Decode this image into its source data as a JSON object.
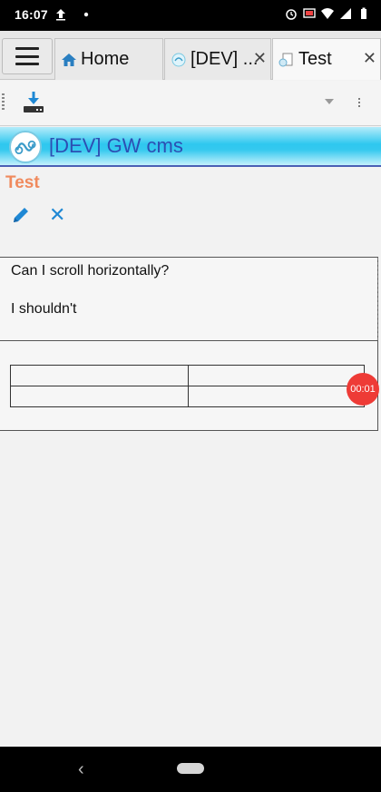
{
  "status_bar": {
    "time": "16:07",
    "icons": [
      "upload-icon",
      "dot-icon",
      "alarm-icon",
      "cast-icon",
      "wifi-icon",
      "signal-icon",
      "battery-icon"
    ]
  },
  "tabs": [
    {
      "label": "Home",
      "icon": "home-icon",
      "closable": false,
      "active": false
    },
    {
      "label": "[DEV] ...",
      "icon": "gw-cms-icon",
      "closable": true,
      "active": false
    },
    {
      "label": "Test",
      "icon": "document-icon",
      "closable": true,
      "active": true
    }
  ],
  "tab_close_glyph": "✕",
  "toolbar": {
    "download_icon": "download-icon",
    "dropdown_icon": "dropdown-arrow-icon",
    "overflow_icon": "overflow-menu-icon"
  },
  "banner": {
    "title": "[DEV] GW cms",
    "logo_icon": "gw-cms-logo"
  },
  "page": {
    "title": "Test",
    "edit_icon": "pencil-icon",
    "close_glyph": "✕"
  },
  "content": {
    "line1": "Can I scroll horizontally?",
    "line2": "I shouldn't"
  },
  "table": {
    "rows": [
      [
        "",
        ""
      ],
      [
        "",
        ""
      ]
    ]
  },
  "timer": {
    "label": "00:01"
  },
  "colors": {
    "title_orange": "#f08a5d",
    "accent_blue": "#1f88d4",
    "banner_title": "#2d4fb3",
    "timer_red": "#ee3b36"
  },
  "nav_bar": {
    "back_glyph": "‹"
  }
}
